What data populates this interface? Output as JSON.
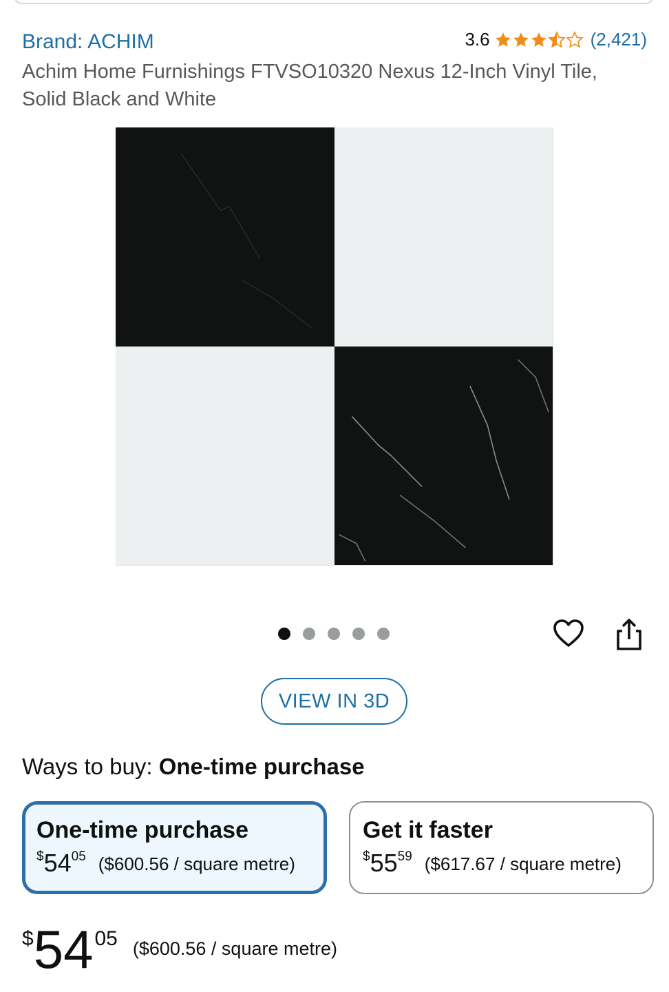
{
  "header": {
    "brand_label": "Brand: ACHIM",
    "rating_value": "3.6",
    "rating_stars": 3.6,
    "rating_count": "(2,421)",
    "title_line1": "Achim Home Furnishings FTVSO10320 Nexus 12-Inch Vinyl Tile,",
    "title_line2": "Solid Black and White"
  },
  "gallery": {
    "image_count": 5,
    "active_index": 0
  },
  "actions": {
    "view3d_label": "VIEW IN 3D",
    "heart_icon": "heart-icon",
    "share_icon": "share-icon"
  },
  "ways_to_buy": {
    "label": "Ways to buy:",
    "selected_label": "One-time purchase",
    "options": [
      {
        "title": "One-time purchase",
        "currency": "$",
        "price_whole": "54",
        "price_fraction": "05",
        "unit_price": "($600.56 / square metre)"
      },
      {
        "title": "Get it faster",
        "currency": "$",
        "price_whole": "55",
        "price_fraction": "59",
        "unit_price": "($617.67 / square metre)"
      }
    ]
  },
  "price": {
    "currency": "$",
    "whole": "54",
    "fraction": "05",
    "unit_price": "($600.56 / square metre)"
  },
  "colors": {
    "link": "#1d6fa5",
    "star": "#f08c1a",
    "selected_border": "#2f6ea8",
    "selected_bg": "#edf7fd"
  }
}
